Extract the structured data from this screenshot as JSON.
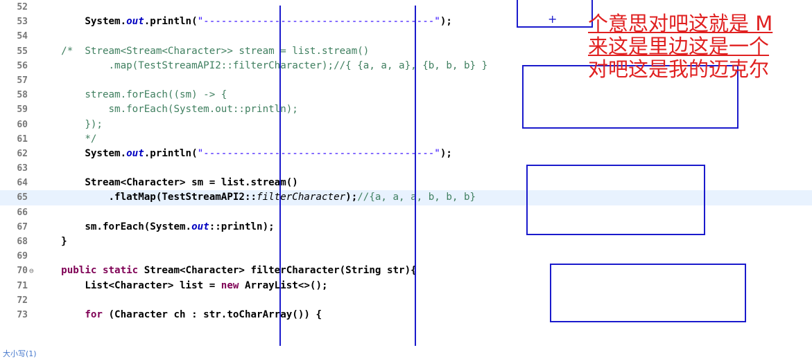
{
  "editor": {
    "lines": [
      {
        "num": "52",
        "segments": []
      },
      {
        "num": "53",
        "segments": [
          {
            "t": "        System.",
            "c": ""
          },
          {
            "t": "out",
            "c": "it"
          },
          {
            "t": ".println(",
            "c": ""
          },
          {
            "t": "\"---------------------------------------\"",
            "c": "st"
          },
          {
            "t": ");",
            "c": ""
          }
        ]
      },
      {
        "num": "54",
        "segments": []
      },
      {
        "num": "55",
        "segments": [
          {
            "t": "    /*  Stream<Stream<Character>> stream = list.stream()",
            "c": "cm"
          }
        ]
      },
      {
        "num": "56",
        "segments": [
          {
            "t": "            .map(TestStreamAPI2::filterCharacter);//{ {a, a, a}, {b, b, b} }",
            "c": "cm"
          }
        ]
      },
      {
        "num": "57",
        "segments": []
      },
      {
        "num": "58",
        "segments": [
          {
            "t": "        stream.forEach((sm) -> {",
            "c": "cm"
          }
        ]
      },
      {
        "num": "59",
        "segments": [
          {
            "t": "            sm.forEach(System.out::println);",
            "c": "cm"
          }
        ]
      },
      {
        "num": "60",
        "segments": [
          {
            "t": "        });",
            "c": "cm"
          }
        ]
      },
      {
        "num": "61",
        "segments": [
          {
            "t": "        */",
            "c": "cm"
          }
        ]
      },
      {
        "num": "62",
        "segments": [
          {
            "t": "        System.",
            "c": ""
          },
          {
            "t": "out",
            "c": "it"
          },
          {
            "t": ".println(",
            "c": ""
          },
          {
            "t": "\"---------------------------------------\"",
            "c": "st"
          },
          {
            "t": ");",
            "c": ""
          }
        ]
      },
      {
        "num": "63",
        "segments": []
      },
      {
        "num": "64",
        "segments": [
          {
            "t": "        Stream<Character> sm = list.stream()",
            "c": ""
          }
        ]
      },
      {
        "num": "65",
        "current": true,
        "segments": [
          {
            "t": "            .flatMap(TestStreamAPI2::",
            "c": ""
          },
          {
            "t": "filterCharacter",
            "c": "itc"
          },
          {
            "t": ");",
            "c": ""
          },
          {
            "t": "//{a, a, a, b, b, b}",
            "c": "cm"
          }
        ]
      },
      {
        "num": "66",
        "segments": []
      },
      {
        "num": "67",
        "segments": [
          {
            "t": "        sm.forEach(System.",
            "c": ""
          },
          {
            "t": "out",
            "c": "it"
          },
          {
            "t": "::println);",
            "c": ""
          }
        ]
      },
      {
        "num": "68",
        "segments": [
          {
            "t": "    }",
            "c": ""
          }
        ]
      },
      {
        "num": "69",
        "segments": []
      },
      {
        "num": "70",
        "fold": true,
        "segments": [
          {
            "t": "    ",
            "c": ""
          },
          {
            "t": "public static",
            "c": "kw"
          },
          {
            "t": " Stream<Character> filterCharacter(String str){",
            "c": ""
          }
        ]
      },
      {
        "num": "71",
        "segments": [
          {
            "t": "        List<Character> list = ",
            "c": ""
          },
          {
            "t": "new",
            "c": "kw"
          },
          {
            "t": " ArrayList<>();",
            "c": ""
          }
        ]
      },
      {
        "num": "72",
        "segments": []
      },
      {
        "num": "73",
        "segments": [
          {
            "t": "        ",
            "c": ""
          },
          {
            "t": "for",
            "c": "kw"
          },
          {
            "t": " (Character ch : str.toCharArray()) {",
            "c": ""
          }
        ]
      }
    ]
  },
  "annotation": {
    "lines": [
      "个意思对吧这就是 M",
      "来这是里边这是一个",
      "对吧这是我的迈克尔"
    ],
    "plus": "+"
  },
  "colors": {
    "annotation_red": "#e02020",
    "pen_blue": "#1a1acc",
    "keyword": "#7f0055",
    "comment": "#3f7f5f",
    "string": "#2a00ff"
  },
  "status": {
    "text": "大小写(1)"
  }
}
